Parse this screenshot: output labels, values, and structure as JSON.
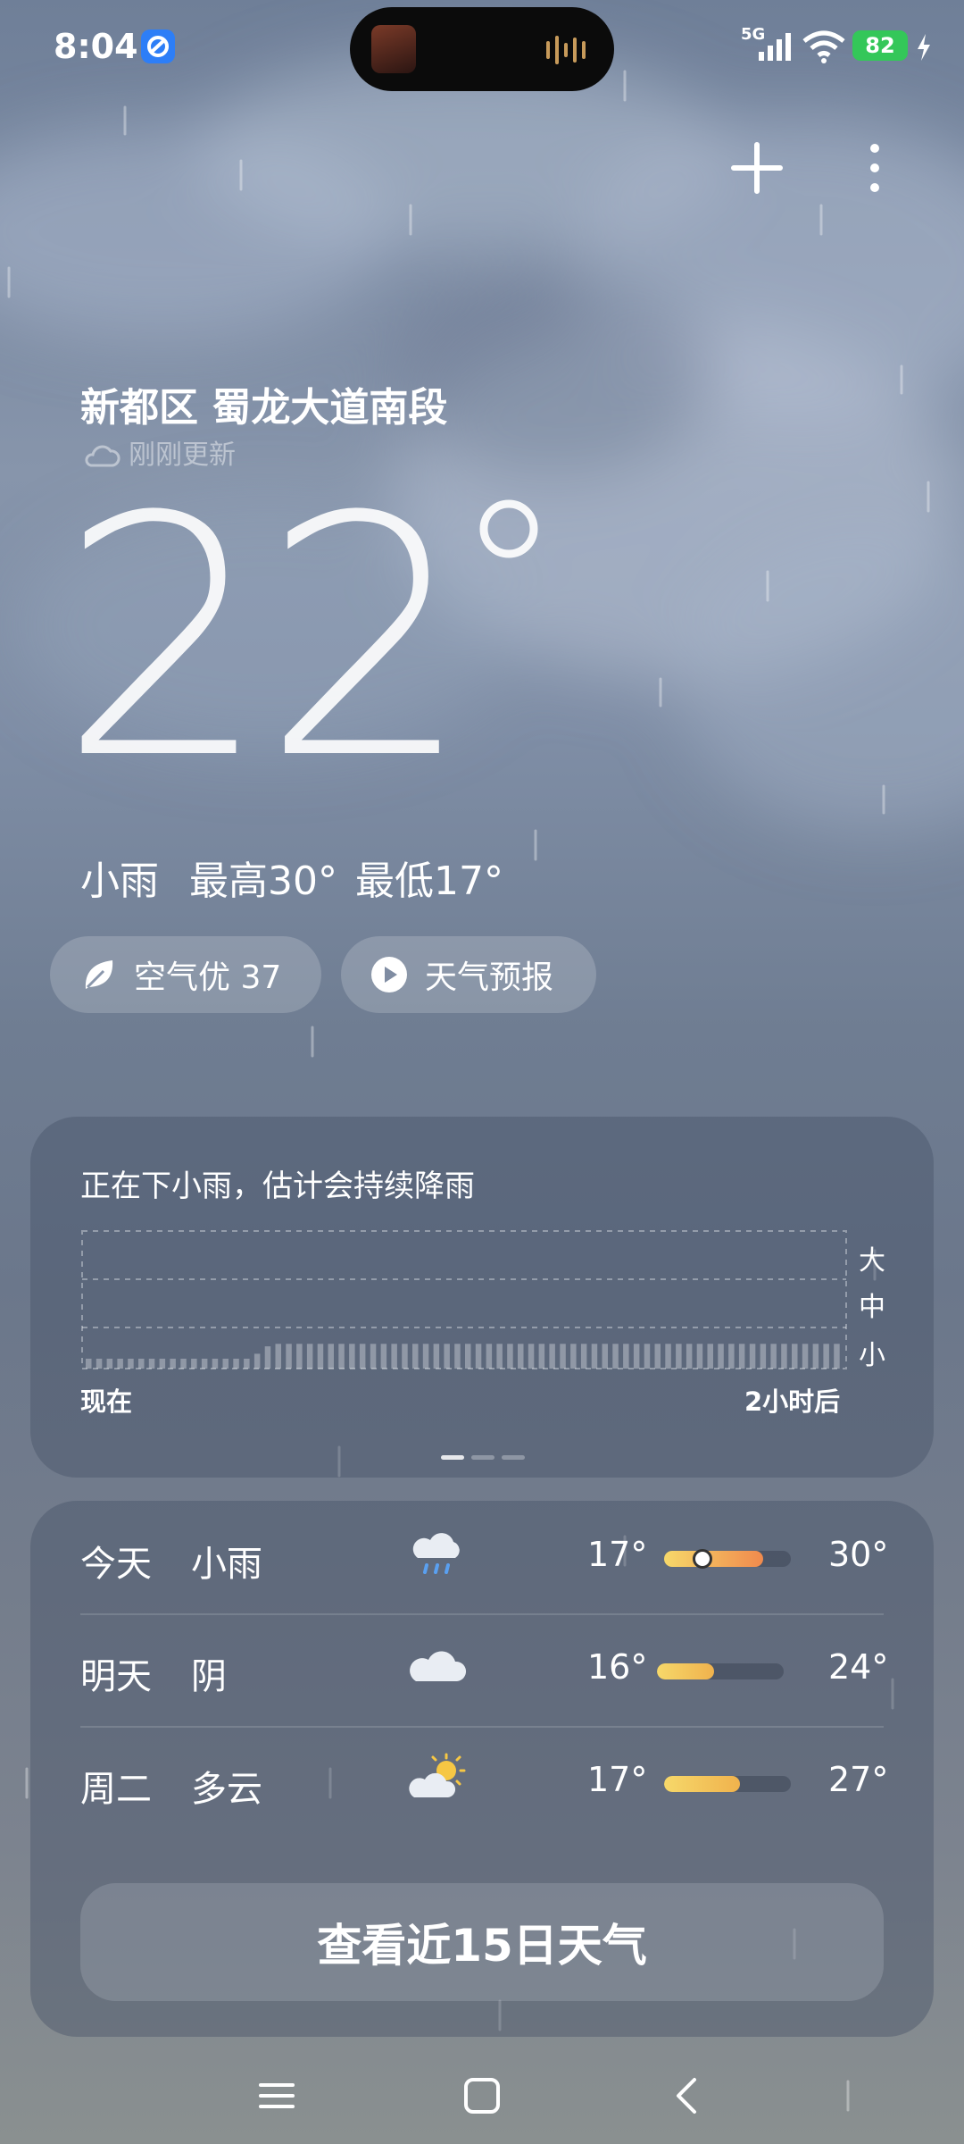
{
  "status_bar": {
    "time": "8:04",
    "network": "5G",
    "battery": "82"
  },
  "location": {
    "name": "新都区 蜀龙大道南段",
    "updated": "刚刚更新"
  },
  "current": {
    "temperature": "22",
    "condition": "小雨",
    "high": "最高30°",
    "low": "最低17°"
  },
  "pills": {
    "air_quality": "空气优 37",
    "forecast_video": "天气预报"
  },
  "rain_card": {
    "title": "正在下小雨，估计会持续降雨",
    "now_label": "现在",
    "end_label": "2小时后",
    "levels": [
      "大",
      "中",
      "小"
    ],
    "intensity": [
      0.2,
      0.2,
      0.2,
      0.2,
      0.2,
      0.2,
      0.2,
      0.2,
      0.2,
      0.2,
      0.2,
      0.2,
      0.2,
      0.2,
      0.2,
      0.2,
      0.3,
      0.45,
      0.5,
      0.5,
      0.5,
      0.5,
      0.5,
      0.5,
      0.5,
      0.5,
      0.5,
      0.5,
      0.5,
      0.5,
      0.5,
      0.5,
      0.5,
      0.5,
      0.5,
      0.5,
      0.5,
      0.5,
      0.5,
      0.5,
      0.5,
      0.5,
      0.5,
      0.5,
      0.5,
      0.5,
      0.5,
      0.5,
      0.5,
      0.5,
      0.5,
      0.5,
      0.5,
      0.5,
      0.5,
      0.5,
      0.5,
      0.5,
      0.5,
      0.5,
      0.5,
      0.5,
      0.5,
      0.5,
      0.5,
      0.5,
      0.5,
      0.5,
      0.5,
      0.5,
      0.5,
      0.5
    ],
    "page_count": 3,
    "active_page": 0
  },
  "forecast": [
    {
      "day": "今天",
      "condition": "小雨",
      "icon": "rain-cloud-icon",
      "low": "17°",
      "high": "30°",
      "range_start": 0.0,
      "range_end": 0.78,
      "current_pos": 0.3
    },
    {
      "day": "明天",
      "condition": "阴",
      "icon": "overcast-cloud-icon",
      "low": "16°",
      "high": "24°",
      "range_start": 0.0,
      "range_end": 0.45
    },
    {
      "day": "周二",
      "condition": "多云",
      "icon": "partly-cloudy-icon",
      "low": "17°",
      "high": "27°",
      "range_start": 0.0,
      "range_end": 0.6
    }
  ],
  "view_15_days": "查看近15日天气",
  "colors": {
    "battery": "#34c759",
    "temp_bar_warm": "#f0b24d",
    "temp_bar_hot": "#f08a4d"
  }
}
